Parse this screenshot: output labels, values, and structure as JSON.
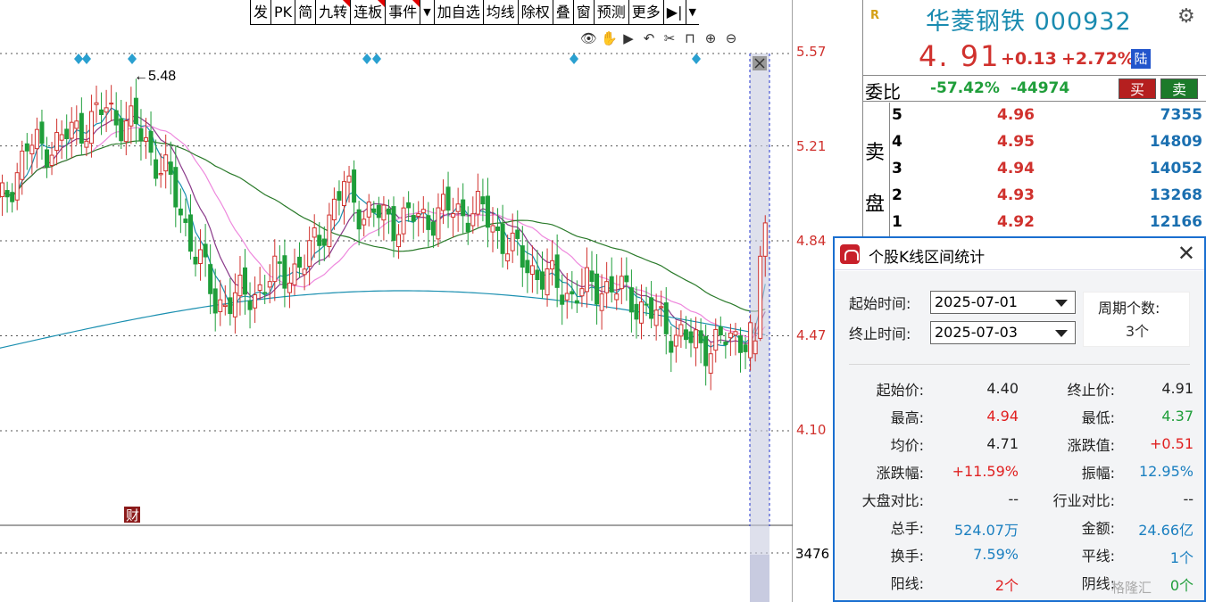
{
  "toolbar": {
    "buttons": [
      "发",
      "PK",
      "简",
      "九转",
      "连板",
      "事件",
      "加自选",
      "均线",
      "除权",
      "叠",
      "窗",
      "预测",
      "更多"
    ],
    "flagged": [
      3,
      4,
      5
    ]
  },
  "icons": [
    "eye-icon",
    "hand-icon",
    "play-icon",
    "undo-icon",
    "scissors-icon",
    "lock-icon",
    "zoom-in-icon",
    "zoom-out-icon"
  ],
  "price_scale": {
    "labels": [
      "5.57",
      "5.21",
      "4.84",
      "4.47",
      "4.10"
    ],
    "volume_label": "3476"
  },
  "chart_data": {
    "type": "candlestick",
    "high_marker_label": "5.48",
    "event_marker": "财",
    "ylim": [
      4.0,
      5.6
    ],
    "price_ticks": [
      5.57,
      5.21,
      4.84,
      4.47,
      4.1
    ],
    "colors": {
      "up": "#d0312d",
      "down": "#1f9e3a",
      "ma5": "#1a8fb0",
      "ma10": "#8a3a8a",
      "ma20": "#ee88dd",
      "ma60": "#2a7a2a",
      "ma120": "#1a8fb0"
    }
  },
  "quote": {
    "r_badge": "R",
    "name": "华菱钢铁 000932",
    "price": "4. 91",
    "change": "+0.13",
    "change_pct": "+2.72%",
    "market": "陆",
    "weibi_label": "委比",
    "weibi_pct": "-57.42%",
    "weibi_vol": "-44974",
    "buy_btn": "买",
    "sell_btn": "卖",
    "sell_side_label": "卖盘",
    "orderbook": [
      {
        "level": "5",
        "price": "4.96",
        "vol": "7355"
      },
      {
        "level": "4",
        "price": "4.95",
        "vol": "14809"
      },
      {
        "level": "3",
        "price": "4.94",
        "vol": "14052"
      },
      {
        "level": "2",
        "price": "4.93",
        "vol": "13268"
      },
      {
        "level": "1",
        "price": "4.92",
        "vol": "12166"
      }
    ]
  },
  "dialog": {
    "title": "个股K线区间统计",
    "start_label": "起始时间:",
    "start_value": "2025-07-01",
    "end_label": "终止时间:",
    "end_value": "2025-07-03",
    "period_label": "周期个数:",
    "period_value": "3个",
    "stats": {
      "start_price_label": "起始价:",
      "start_price": "4.40",
      "end_price_label": "终止价:",
      "end_price": "4.91",
      "high_label": "最高:",
      "high": "4.94",
      "low_label": "最低:",
      "low": "4.37",
      "avg_label": "均价:",
      "avg": "4.71",
      "change_label": "涨跌值:",
      "change": "+0.51",
      "pct_label": "涨跌幅:",
      "pct": "+11.59%",
      "amp_label": "振幅:",
      "amp": "12.95%",
      "market_cmp_label": "大盘对比:",
      "market_cmp": "--",
      "industry_cmp_label": "行业对比:",
      "industry_cmp": "--",
      "vol_label": "总手:",
      "vol": "524.07万",
      "amount_label": "金额:",
      "amount": "24.66亿",
      "turnover_label": "换手:",
      "turnover": "7.59%",
      "flat_label": "平线:",
      "flat": "1个",
      "up_label": "阳线:",
      "up": "2个",
      "down_label": "阴线:",
      "down": "0个"
    }
  },
  "watermark": "格隆汇"
}
